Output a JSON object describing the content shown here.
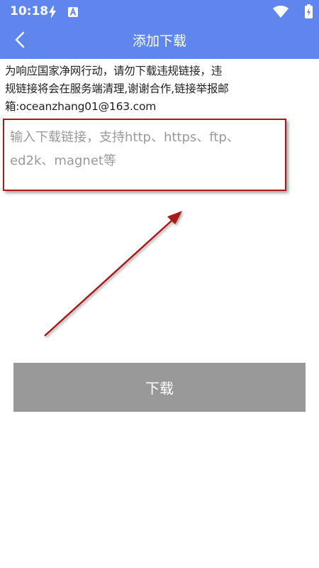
{
  "status_bar": {
    "time": "10:18",
    "icons": [
      "flash-icon",
      "a-notification-icon",
      "wifi-icon",
      "battery-charging-icon"
    ]
  },
  "app_bar": {
    "title": "添加下载",
    "back_icon": "chevron-left-icon",
    "background_color": "#5e86ec"
  },
  "notice": {
    "lines": [
      "为响应国家净网行动，请勿下载违规链接，违",
      "规链接将会在服务端清理,谢谢合作,链接举报邮",
      "箱:oceanzhang01@163.com"
    ]
  },
  "link_input": {
    "value": "",
    "placeholder": "输入下载链接，支持http、https、ftp、ed2k、magnet等"
  },
  "download_button": {
    "label": "下载",
    "color": "#999999"
  },
  "annotation": {
    "highlight_color": "#a61c1c"
  }
}
